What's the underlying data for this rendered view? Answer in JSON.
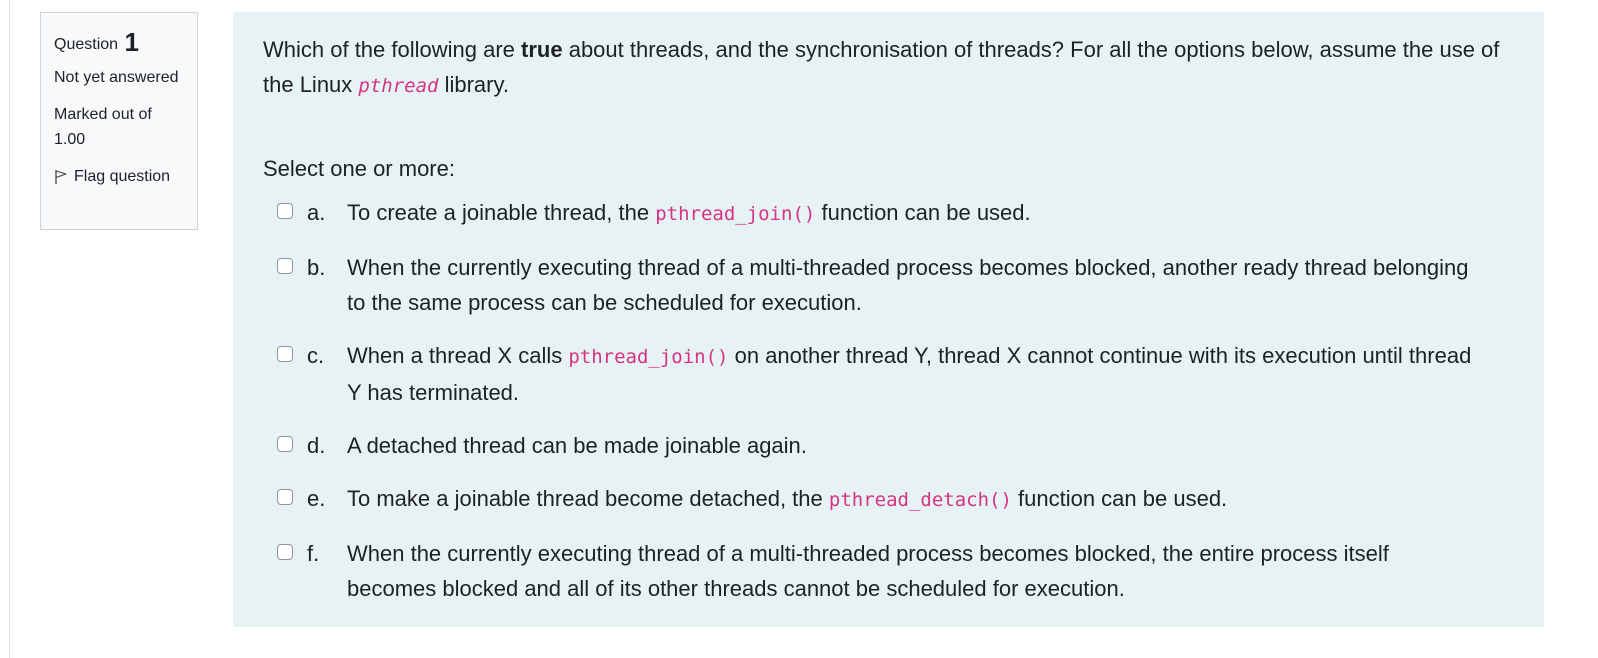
{
  "info": {
    "question_label": "Question",
    "question_number": "1",
    "state": "Not yet answered",
    "grade": "Marked out of 1.00",
    "flag_label": "Flag question"
  },
  "question": {
    "text_before": "Which of the following are ",
    "text_bold": "true",
    "text_after": " about threads, and the synchronisation of threads? For all the options below, assume the use of the Linux ",
    "library_code": "pthread",
    "text_end": " library.",
    "prompt": "Select one or more:"
  },
  "options": [
    {
      "letter": "a.",
      "before": "To create a joinable thread, the ",
      "code": "pthread_join()",
      "after": " function can be used."
    },
    {
      "letter": "b.",
      "before": "When the currently executing thread of a multi-threaded process becomes blocked, another ready thread belonging to the same process can be scheduled for execution.",
      "code": "",
      "after": ""
    },
    {
      "letter": "c.",
      "before": "When a thread X calls ",
      "code": "pthread_join()",
      "after": " on another thread Y, thread X cannot continue with its execution until thread Y has terminated."
    },
    {
      "letter": "d.",
      "before": "A detached thread can be made joinable again.",
      "code": "",
      "after": ""
    },
    {
      "letter": "e.",
      "before": "To make a joinable thread become detached, the ",
      "code": "pthread_detach()",
      "after": " function can be used."
    },
    {
      "letter": "f.",
      "before": "When the currently executing thread of a multi-threaded process becomes blocked, the entire process itself becomes blocked and all of its other threads cannot be scheduled for execution.",
      "code": "",
      "after": ""
    }
  ],
  "colors": {
    "content_bg": "#e7f2f4",
    "info_bg": "#f8f9fa",
    "code": "#d63384"
  }
}
